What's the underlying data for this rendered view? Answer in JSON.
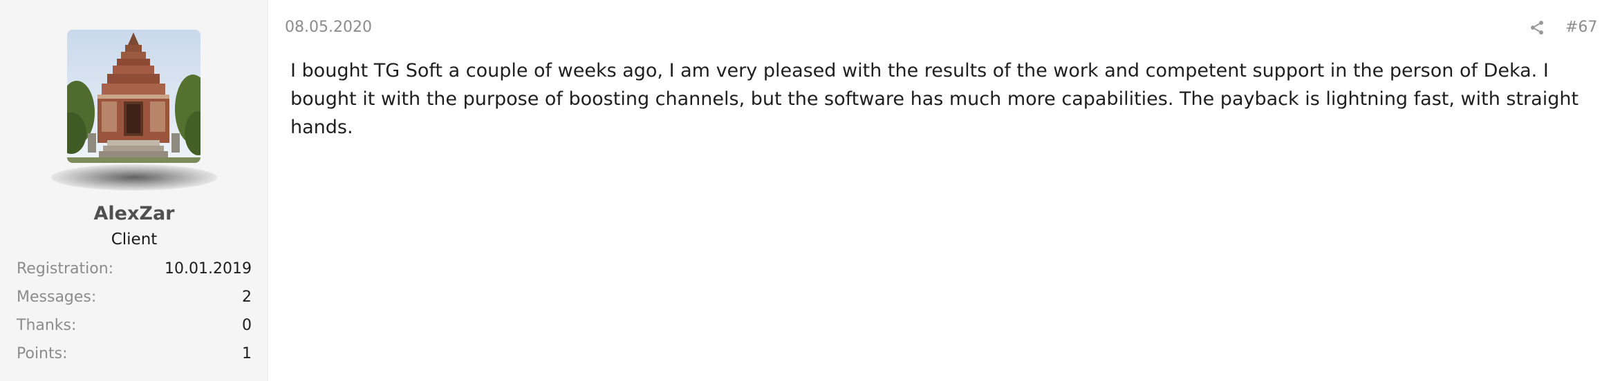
{
  "user": {
    "avatar_icon": "avatar-temple-photo",
    "name": "AlexZar",
    "title": "Client",
    "stats": [
      {
        "label": "Registration:",
        "value": "10.01.2019"
      },
      {
        "label": "Messages:",
        "value": "2"
      },
      {
        "label": "Thanks:",
        "value": "0"
      },
      {
        "label": "Points:",
        "value": "1"
      }
    ]
  },
  "post": {
    "date": "08.05.2020",
    "share_icon": "share-icon",
    "number": "#67",
    "body": "I bought TG Soft a couple of weeks ago, I am very pleased with the results of the work and competent support in the person of Deka. I bought it with the purpose of boosting channels, but the software has much more capabilities. The payback is lightning fast, with straight hands."
  },
  "colors": {
    "sidebar_bg": "#f5f5f5",
    "muted_text": "#8c8c8c",
    "body_text": "#1f1f1f",
    "username": "#505050"
  }
}
